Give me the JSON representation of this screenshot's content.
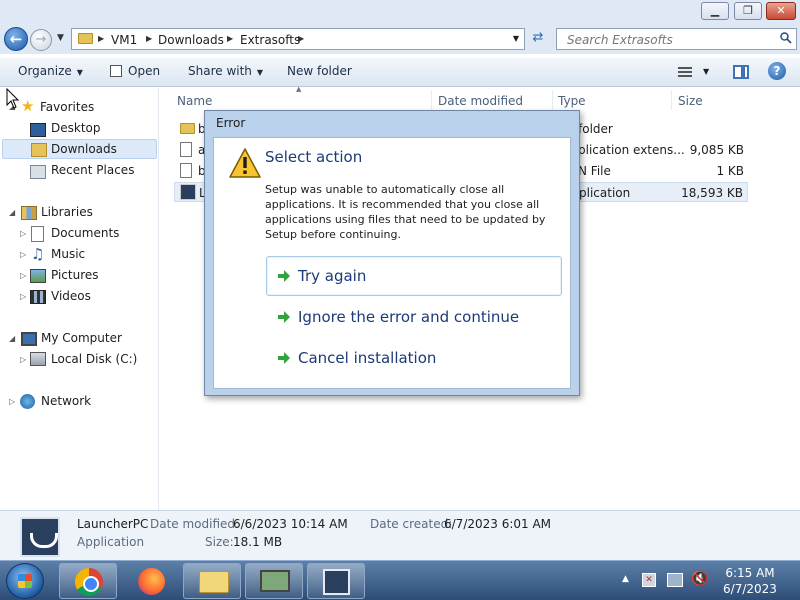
{
  "window": {
    "controls": {
      "minimize": "▁",
      "maximize": "❐",
      "close": "✕"
    }
  },
  "address": {
    "crumbs": [
      "VM1",
      "Downloads",
      "Extrasofts"
    ],
    "search_placeholder": "Search Extrasofts"
  },
  "toolbar": {
    "organize": "Organize",
    "open": "Open",
    "share_with": "Share with",
    "new_folder": "New folder"
  },
  "nav": {
    "favorites": "Favorites",
    "desktop": "Desktop",
    "downloads": "Downloads",
    "recent_places": "Recent Places",
    "libraries": "Libraries",
    "documents": "Documents",
    "music": "Music",
    "pictures": "Pictures",
    "videos": "Videos",
    "my_computer": "My Computer",
    "local_disk": "Local Disk (C:)",
    "network": "Network"
  },
  "columns": {
    "name": "Name",
    "date_modified": "Date modified",
    "type": "Type",
    "size": "Size"
  },
  "files": [
    {
      "name": "b",
      "type": "folder",
      "size": ""
    },
    {
      "name": "a",
      "type": "plication extens...",
      "size": "9,085 KB"
    },
    {
      "name": "b",
      "type": "N File",
      "size": "1 KB"
    },
    {
      "name": "L",
      "type": "plication",
      "size": "18,593 KB"
    }
  ],
  "details": {
    "name": "LauncherPC",
    "kind": "Application",
    "date_modified_label": "Date modified:",
    "date_modified": "6/6/2023 10:14 AM",
    "date_created_label": "Date created:",
    "date_created": "6/7/2023 6:01 AM",
    "size_label": "Size:",
    "size": "18.1 MB"
  },
  "dialog": {
    "title": "Error",
    "heading": "Select action",
    "message": "Setup was unable to automatically close all applications. It is recommended that you close all applications using files that need to be updated by Setup before continuing.",
    "options": [
      "Try again",
      "Ignore the error and continue",
      "Cancel installation"
    ]
  },
  "taskbar": {
    "time": "6:15 AM",
    "date": "6/7/2023"
  },
  "colors": {
    "link_blue": "#1c3a78",
    "dialog_frame": "#b9d1ea",
    "taskbar": "#2d4d77"
  }
}
